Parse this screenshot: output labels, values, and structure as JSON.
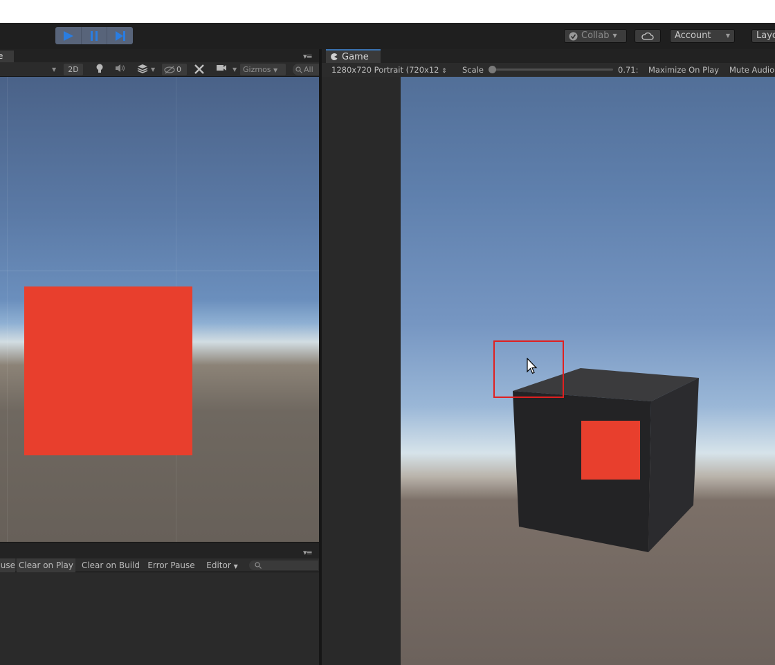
{
  "toolbar": {
    "collab_label": "Collab",
    "account_label": "Account",
    "layout_label": "Layo",
    "play_controls": [
      "play-icon",
      "pause-icon",
      "step-icon"
    ]
  },
  "scene": {
    "tab_label": "e",
    "mode_2d": "2D",
    "hidden_count": "0",
    "gizmos_label": "Gizmos",
    "search_placeholder": "All"
  },
  "console": {
    "buttons": [
      "use",
      "Clear on Play",
      "Clear on Build",
      "Error Pause"
    ],
    "editor_dropdown": "Editor"
  },
  "game": {
    "tab_label": "Game",
    "resolution": "1280x720 Portrait (720x12",
    "scale_label": "Scale",
    "scale_value": "0.71",
    "maximize_label": "Maximize On Play",
    "mute_label": "Mute Audio"
  },
  "colors": {
    "accent_red": "#e83f2d",
    "highlight": "#e02020",
    "play_blue": "#2a7de1"
  }
}
